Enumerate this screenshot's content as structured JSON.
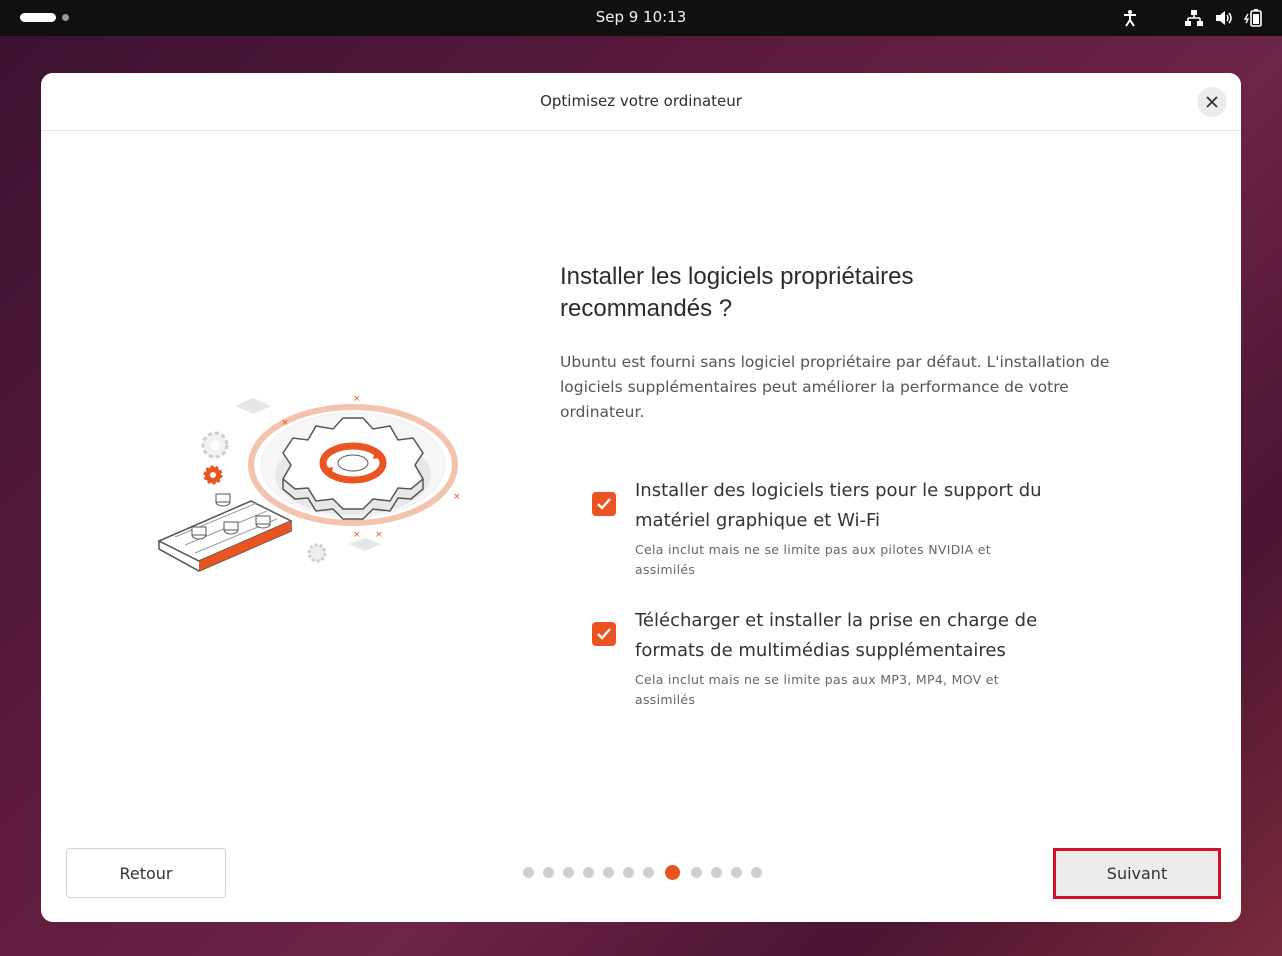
{
  "topbar": {
    "clock": "Sep 9  10:13",
    "icons": [
      "activities-pill",
      "accessibility-icon",
      "network-icon",
      "volume-icon",
      "battery-icon"
    ]
  },
  "dialog": {
    "title": "Optimisez votre ordinateur",
    "heading": "Installer les logiciels propriétaires recommandés ?",
    "description": "Ubuntu est fourni sans logiciel propriétaire par défaut. L'installation de logiciels supplémentaires peut améliorer la performance de votre ordinateur.",
    "options": [
      {
        "label": "Installer des logiciels tiers pour le support du matériel graphique et Wi-Fi",
        "note": "Cela inclut mais ne se limite pas aux pilotes NVIDIA et assimilés",
        "checked": true
      },
      {
        "label": "Télécharger et installer la prise en charge de formats de multimédias supplémentaires",
        "note": "Cela inclut mais ne se limite pas aux MP3, MP4, MOV et assimilés",
        "checked": true
      }
    ],
    "back_label": "Retour",
    "next_label": "Suivant",
    "progress": {
      "total_steps": 12,
      "current_step": 8
    }
  },
  "colors": {
    "accent": "#e95420",
    "highlight_border": "#d3102a"
  }
}
